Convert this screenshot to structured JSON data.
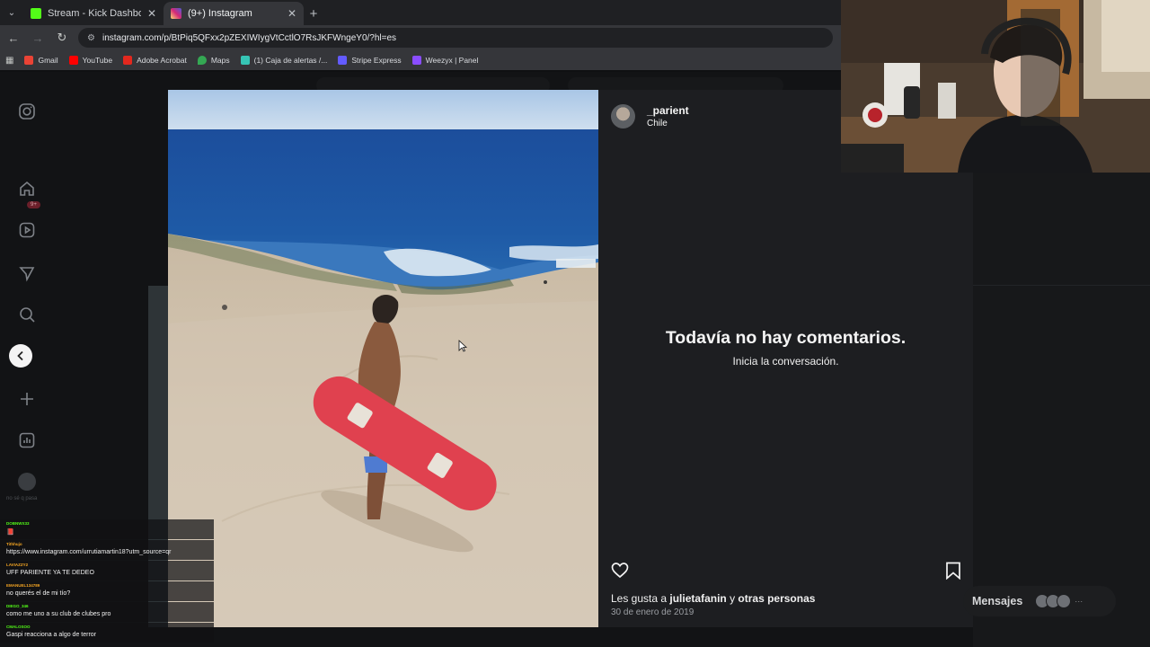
{
  "browser": {
    "tabs": [
      {
        "title": "Stream - Kick Dashboard",
        "favicon_color": "#53fc18",
        "active": false
      },
      {
        "title": "(9+) Instagram",
        "favicon_color": "#d62976",
        "active": true
      }
    ],
    "url": "instagram.com/p/BtPiq5QFxx2pZEXIWIygVtCctlO7RsJKFWngeY0/?hl=es",
    "bookmarks": [
      {
        "label": "Gmail",
        "color": "#ea4335"
      },
      {
        "label": "YouTube",
        "color": "#ff0000"
      },
      {
        "label": "Adobe Acrobat",
        "color": "#e3281e"
      },
      {
        "label": "Maps",
        "color": "#34a853"
      },
      {
        "label": "(1) Caja de alertas /...",
        "color": "#36c5b5"
      },
      {
        "label": "Stripe Express",
        "color": "#635bff"
      },
      {
        "label": "Weezyx | Panel",
        "color": "#8a4dff"
      }
    ]
  },
  "post": {
    "username": "_parient",
    "location": "Chile",
    "no_comments_title": "Todavía no hay comentarios.",
    "no_comments_sub": "Inicia la conversación.",
    "likes_prefix": "Les gusta a ",
    "likes_user": "julietafanin",
    "likes_suffix": " y ",
    "likes_others": "otras personas",
    "date": "30 de enero de 2019"
  },
  "sidebar": {
    "notification_badge": "9+"
  },
  "messages": {
    "label": "Mensajes"
  },
  "chat": {
    "hint": "no sé q pasa",
    "messages": [
      {
        "user": "DOBNWX33",
        "user_color": "#53fc18",
        "text": "📕"
      },
      {
        "user": "Tithhujo",
        "user_color": "#f5a623",
        "text": "https://www.instagram.com/urrutiamartin18?utm_source=qr"
      },
      {
        "user": "LAVIAZZY2",
        "user_color": "#f5a623",
        "text": "UFF PARIENTE YA TE DEDEO"
      },
      {
        "user": "EMANUEL134789",
        "user_color": "#f5a623",
        "text": "no querés el de mi tío?"
      },
      {
        "user": "DIEGO_346",
        "user_color": "#53fc18",
        "text": "como me uno a su club de clubes pro"
      },
      {
        "user": "CMALOSOO",
        "user_color": "#53fc18",
        "text": "Gaspi reacciona a algo de terror"
      }
    ]
  }
}
